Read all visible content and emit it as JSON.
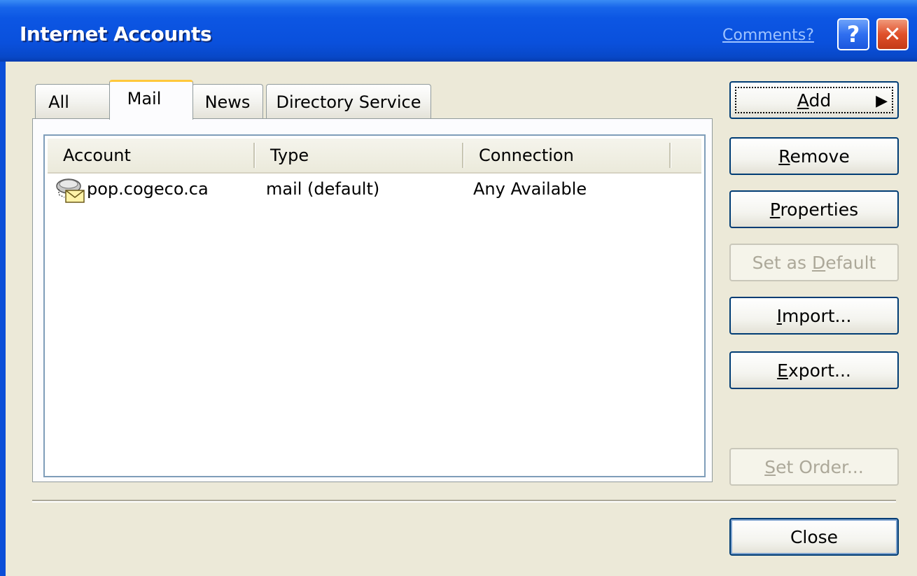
{
  "window": {
    "title": "Internet Accounts",
    "comments_link": "Comments?",
    "help_glyph": "?",
    "close_glyph": "✕"
  },
  "tabs": [
    {
      "label": "All",
      "active": false
    },
    {
      "label": "Mail",
      "active": true
    },
    {
      "label": "News",
      "active": false
    },
    {
      "label": "Directory Service",
      "active": false
    }
  ],
  "list": {
    "columns": [
      "Account",
      "Type",
      "Connection"
    ],
    "rows": [
      {
        "icon": "mail-account-icon",
        "account": "pop.cogeco.ca",
        "type": "mail (default)",
        "connection": "Any Available"
      }
    ]
  },
  "buttons": {
    "add": {
      "pre": "",
      "u": "A",
      "post": "dd",
      "arrow": "▶"
    },
    "remove": {
      "pre": "",
      "u": "R",
      "post": "emove"
    },
    "properties": {
      "pre": "",
      "u": "P",
      "post": "roperties"
    },
    "set_default": {
      "pre": "Set as ",
      "u": "D",
      "post": "efault"
    },
    "import": {
      "pre": "",
      "u": "I",
      "post": "mport..."
    },
    "export": {
      "pre": "",
      "u": "E",
      "post": "xport..."
    },
    "set_order": {
      "pre": "",
      "u": "S",
      "post": "et Order..."
    },
    "close": "Close"
  },
  "colors": {
    "title_blue": "#0a50dc",
    "face": "#ece9d8",
    "button_border": "#003c74",
    "tab_highlight": "#ffc83c",
    "disabled_text": "#aca899"
  }
}
